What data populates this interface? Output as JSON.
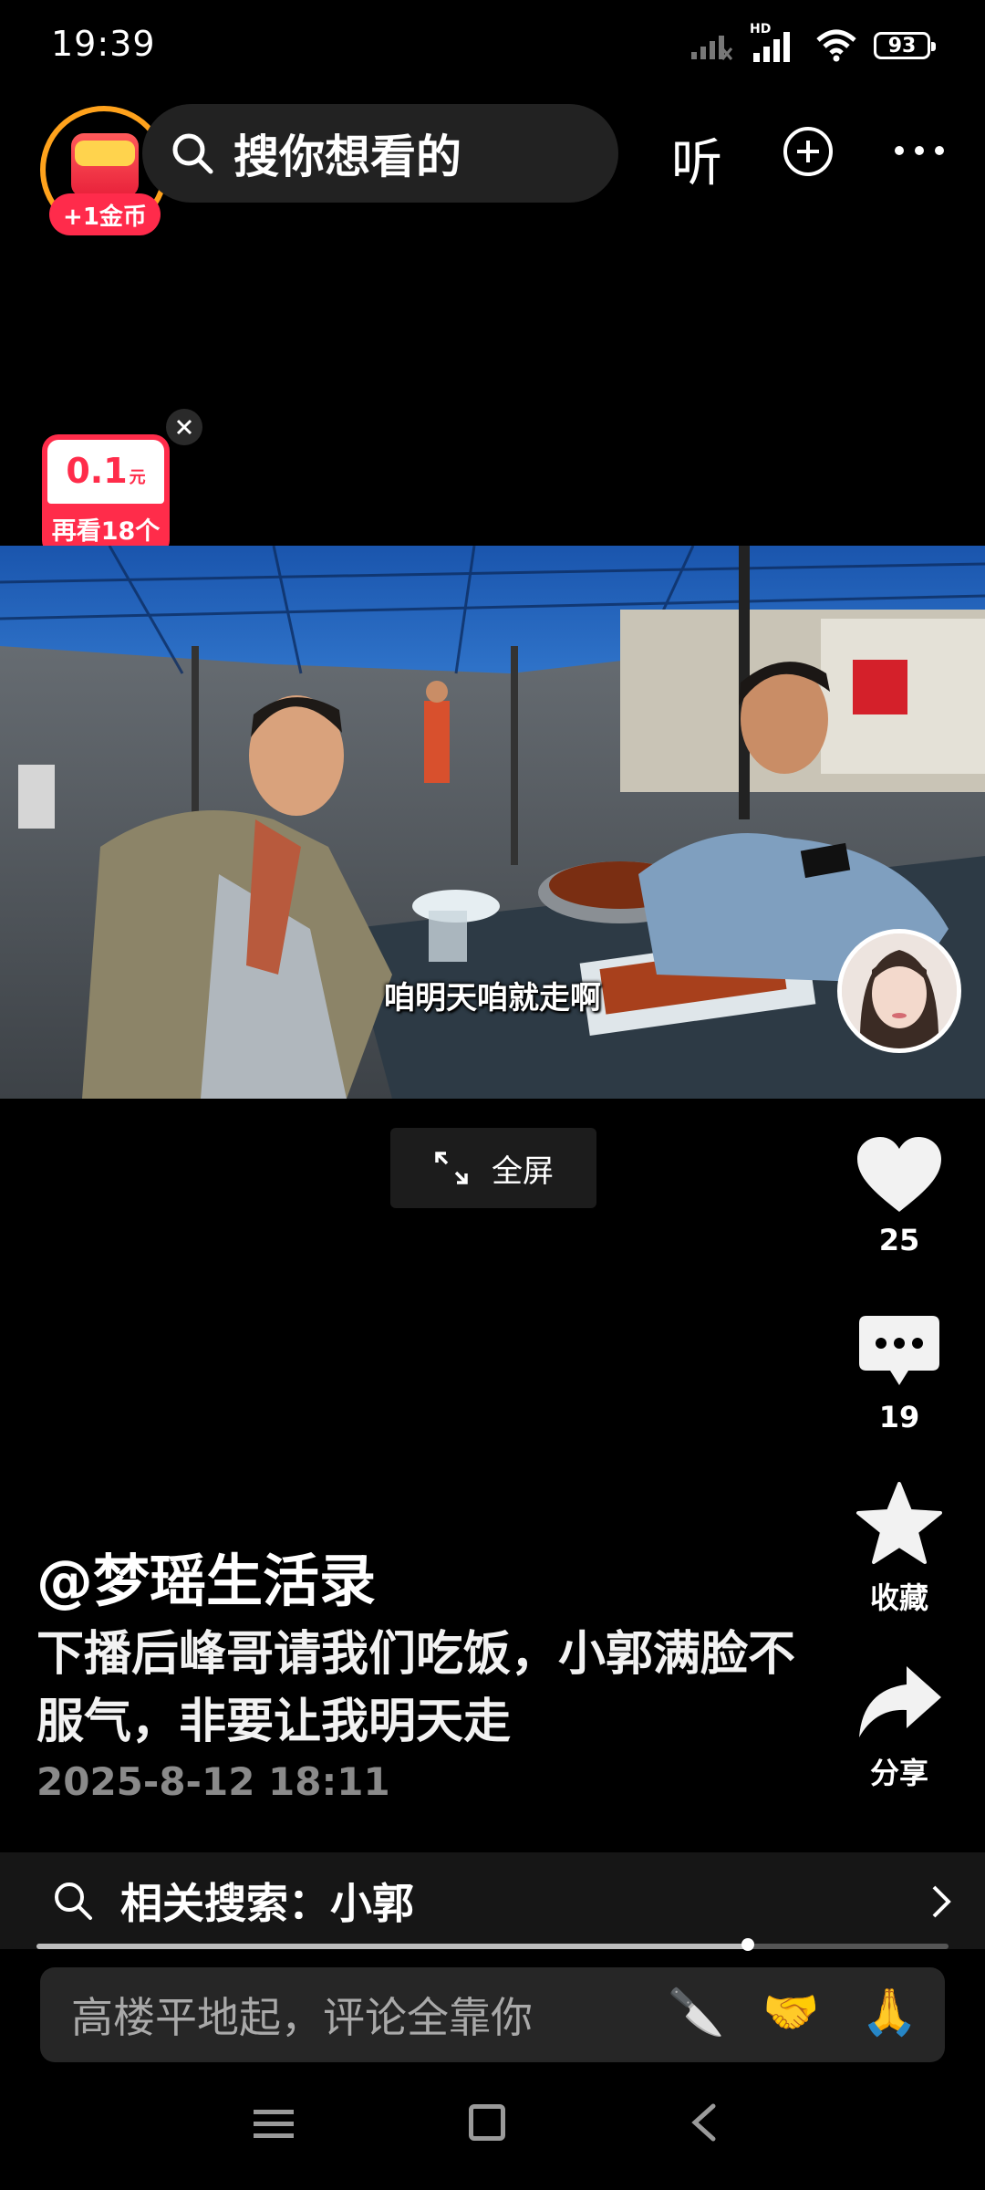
{
  "status_bar": {
    "time": "19:39",
    "hd": "HD",
    "battery": "93",
    "icons": [
      "signal-off-icon",
      "signal-icon",
      "wifi-icon",
      "battery-icon"
    ]
  },
  "top_bar": {
    "coin_badge": "+1金币",
    "search_placeholder": "搜你想看的",
    "listen_label": "听",
    "icons": [
      "search-icon",
      "add-icon",
      "more-icon"
    ]
  },
  "reward": {
    "amount": "0.1",
    "unit": "元",
    "label": "再看18个"
  },
  "video": {
    "subtitle": "咱明天咱就走啊",
    "fullscreen_label": "全屏"
  },
  "actions": {
    "likes": "25",
    "comments": "19",
    "favorite_label": "收藏",
    "share_label": "分享"
  },
  "post": {
    "author": "@梦瑶生活录",
    "description": "下播后峰哥请我们吃饭，小郭满脸不服气，非要让我明天走",
    "date": "2025-8-12 18:11"
  },
  "related_search": {
    "label": "相关搜索：小郭"
  },
  "playback": {
    "progress": 0.78
  },
  "comment_box": {
    "placeholder": "高楼平地起，评论全靠你",
    "emojis": [
      "🔪",
      "🤝",
      "🙏"
    ]
  },
  "colors": {
    "accent_red": "#ff2c4a",
    "coin_ring": "#ffa21c",
    "tent_blue": "#1f5fb8"
  }
}
